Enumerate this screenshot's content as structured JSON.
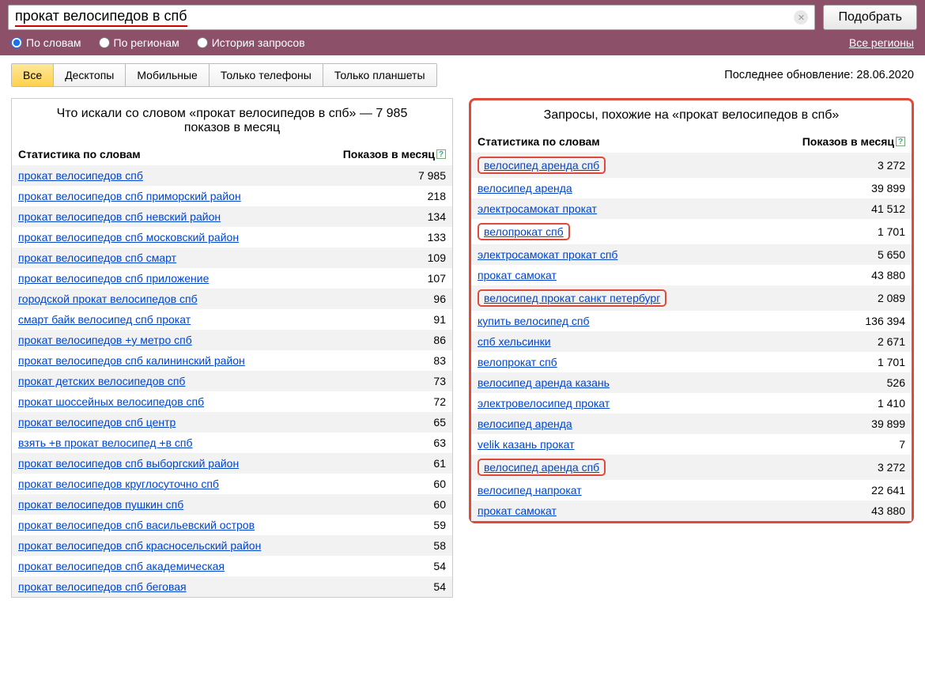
{
  "search": {
    "value": "прокат велосипедов в спб",
    "submit_label": "Подобрать"
  },
  "radios": {
    "by_words": "По словам",
    "by_regions": "По регионам",
    "history": "История запросов",
    "region_link": "Все регионы"
  },
  "tabs": {
    "all": "Все",
    "desktop": "Десктопы",
    "mobile": "Мобильные",
    "phones": "Только телефоны",
    "tablets": "Только планшеты"
  },
  "last_update": "Последнее обновление: 28.06.2020",
  "left": {
    "title": "Что искали со словом «прокат велосипедов в спб» — 7 985 показов в месяц",
    "th_left": "Статистика по словам",
    "th_right": "Показов в месяц",
    "rows": [
      {
        "kw": "прокат велосипедов спб",
        "cnt": "7 985"
      },
      {
        "kw": "прокат велосипедов спб приморский район",
        "cnt": "218"
      },
      {
        "kw": "прокат велосипедов спб невский район",
        "cnt": "134"
      },
      {
        "kw": "прокат велосипедов спб московский район",
        "cnt": "133"
      },
      {
        "kw": "прокат велосипедов спб смарт",
        "cnt": "109"
      },
      {
        "kw": "прокат велосипедов спб приложение",
        "cnt": "107"
      },
      {
        "kw": "городской прокат велосипедов спб",
        "cnt": "96"
      },
      {
        "kw": "смарт байк велосипед спб прокат",
        "cnt": "91"
      },
      {
        "kw": "прокат велосипедов +у метро спб",
        "cnt": "86"
      },
      {
        "kw": "прокат велосипедов спб калининский район",
        "cnt": "83"
      },
      {
        "kw": "прокат детских велосипедов спб",
        "cnt": "73"
      },
      {
        "kw": "прокат шоссейных велосипедов спб",
        "cnt": "72"
      },
      {
        "kw": "прокат велосипедов спб центр",
        "cnt": "65"
      },
      {
        "kw": "взять +в прокат велосипед +в спб",
        "cnt": "63"
      },
      {
        "kw": "прокат велосипедов спб выборгский район",
        "cnt": "61"
      },
      {
        "kw": "прокат велосипедов круглосуточно спб",
        "cnt": "60"
      },
      {
        "kw": "прокат велосипедов пушкин спб",
        "cnt": "60"
      },
      {
        "kw": "прокат велосипедов спб васильевский остров",
        "cnt": "59"
      },
      {
        "kw": "прокат велосипедов спб красносельский район",
        "cnt": "58"
      },
      {
        "kw": "прокат велосипедов спб академическая",
        "cnt": "54"
      },
      {
        "kw": "прокат велосипедов спб беговая",
        "cnt": "54"
      }
    ]
  },
  "right": {
    "title": "Запросы, похожие на «прокат велосипедов в спб»",
    "th_left": "Статистика по словам",
    "th_right": "Показов в месяц",
    "rows": [
      {
        "kw": "велосипед аренда спб",
        "cnt": "3 272",
        "boxed": true
      },
      {
        "kw": "велосипед аренда",
        "cnt": "39 899"
      },
      {
        "kw": "электросамокат прокат",
        "cnt": "41 512"
      },
      {
        "kw": "велопрокат спб",
        "cnt": "1 701",
        "boxed": true
      },
      {
        "kw": "электросамокат прокат спб",
        "cnt": "5 650"
      },
      {
        "kw": "прокат самокат",
        "cnt": "43 880"
      },
      {
        "kw": "велосипед прокат санкт петербург",
        "cnt": "2 089",
        "boxed": true
      },
      {
        "kw": "купить велосипед спб",
        "cnt": "136 394"
      },
      {
        "kw": "спб хельсинки",
        "cnt": "2 671"
      },
      {
        "kw": "велопрокат спб",
        "cnt": "1 701"
      },
      {
        "kw": "велосипед аренда казань",
        "cnt": "526"
      },
      {
        "kw": "электровелосипед прокат",
        "cnt": "1 410"
      },
      {
        "kw": "велосипед аренда",
        "cnt": "39 899"
      },
      {
        "kw": "velik казань прокат",
        "cnt": "7"
      },
      {
        "kw": "велосипед аренда спб",
        "cnt": "3 272",
        "boxed": true
      },
      {
        "kw": "велосипед напрокат",
        "cnt": "22 641"
      },
      {
        "kw": "прокат самокат",
        "cnt": "43 880"
      }
    ]
  }
}
